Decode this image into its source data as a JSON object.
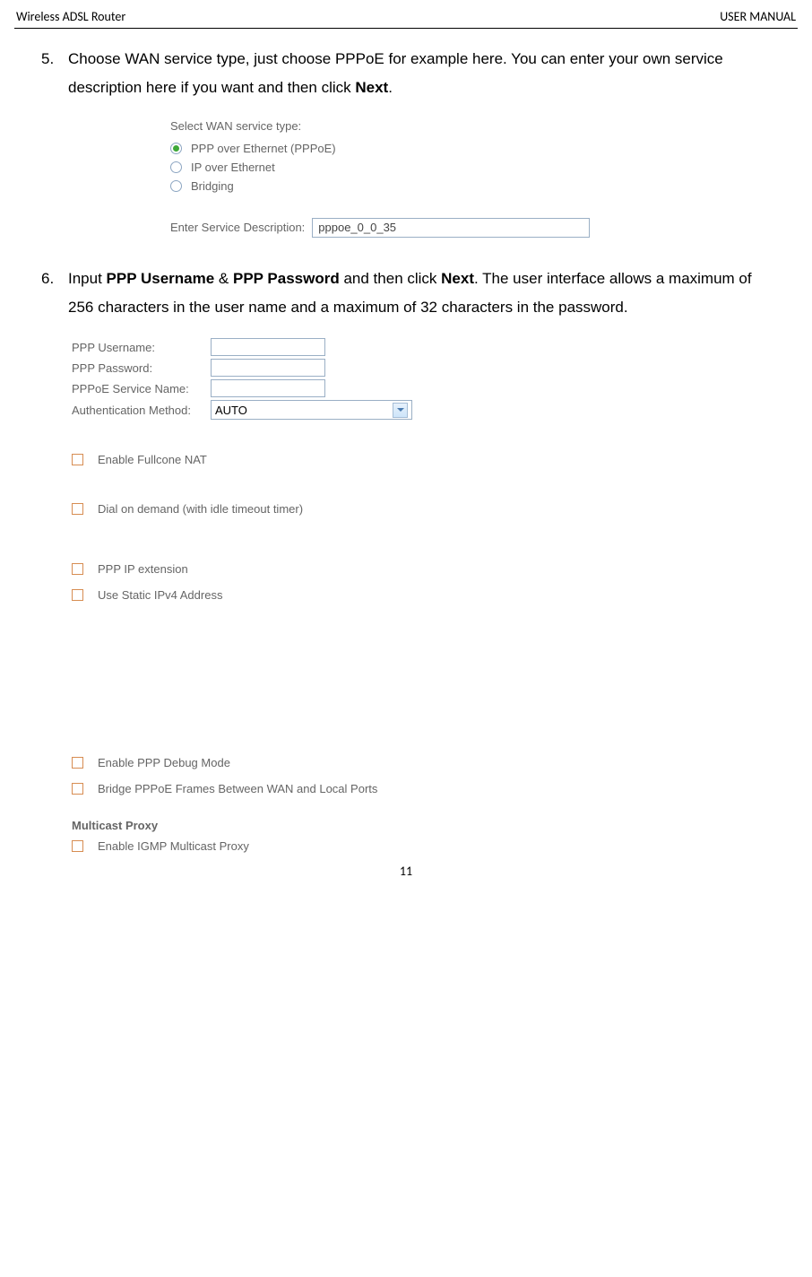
{
  "header": {
    "left": "Wireless ADSL Router",
    "right": "USER MANUAL"
  },
  "step5": {
    "num": "5.",
    "text_prefix": "Choose WAN service type, just choose PPPoE for example here. You can enter your own service description here if you want and then click ",
    "bold1": "Next",
    "text_suffix": "."
  },
  "wan": {
    "title": "Select WAN service type:",
    "opt1": "PPP over Ethernet (PPPoE)",
    "opt2": "IP over Ethernet",
    "opt3": "Bridging",
    "svc_label": "Enter Service Description:",
    "svc_value": "pppoe_0_0_35"
  },
  "step6": {
    "num": "6.",
    "p1": "Input ",
    "b1": "PPP Username",
    "p2": " & ",
    "b2": "PPP Password",
    "p3": " and then click ",
    "b3": "Next",
    "p4": ". The user interface allows a maximum of 256 characters in the user name and a maximum of 32 characters in the password."
  },
  "ppp": {
    "f1": "PPP Username:",
    "f2": "PPP Password:",
    "f3": "PPPoE Service Name:",
    "f4": "Authentication Method:",
    "sel": "AUTO",
    "cb1": "Enable Fullcone NAT",
    "cb2": "Dial on demand (with idle timeout timer)",
    "cb3": "PPP IP extension",
    "cb4": "Use Static IPv4 Address",
    "cb5": "Enable PPP Debug Mode",
    "cb6": "Bridge PPPoE Frames Between WAN and Local Ports",
    "mcast_title": "Multicast Proxy",
    "cb7": "Enable IGMP Multicast Proxy"
  },
  "pagenum": "11"
}
